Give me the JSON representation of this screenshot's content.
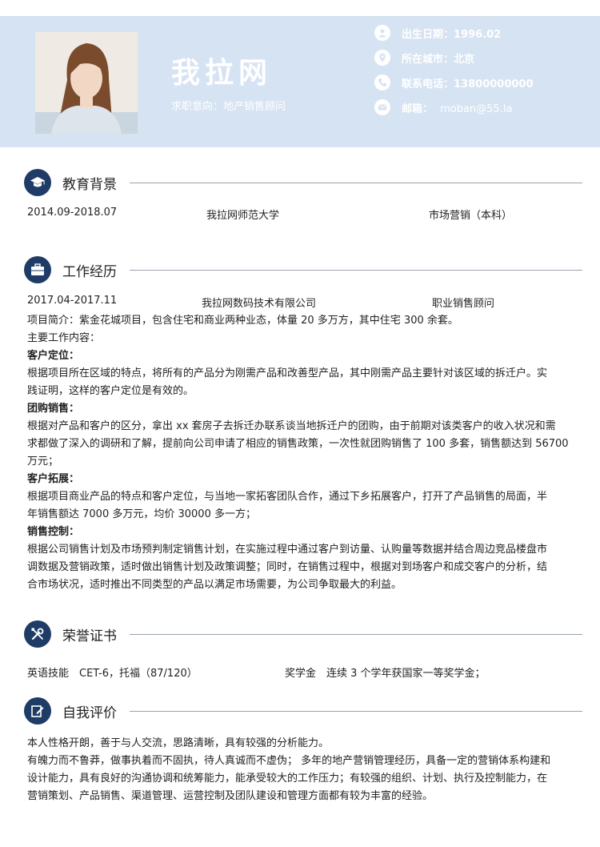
{
  "header": {
    "name": "我拉网",
    "target": "求职意向：地产销售顾问",
    "info": [
      {
        "icon": "user-icon",
        "label": "出生日期：",
        "value": "1996.02"
      },
      {
        "icon": "location-pin-icon",
        "label": "所在城市：",
        "value": "北京"
      },
      {
        "icon": "phone-icon",
        "label": "联系电话：",
        "value": "13800000000"
      },
      {
        "icon": "mail-icon",
        "label": "邮箱：",
        "value": "moban@55.la"
      }
    ]
  },
  "education": {
    "title": "教育背景",
    "period": "2014.09-2018.07",
    "school": "我拉网师范大学",
    "major": "市场营销（本科）"
  },
  "work": {
    "title": "工作经历",
    "period": "2017.04-2017.11",
    "company": "我拉网数码技术有限公司",
    "position": "职业销售顾问",
    "intro": "项目简介：紫金花城项目，包含住宅和商业两种业态，体量 20 多万方，其中住宅 300 余套。",
    "duties_label": "主要工作内容：",
    "items": [
      {
        "heading": "客户定位：",
        "lines": [
          "根据项目所在区域的特点，将所有的产品分为刚需产品和改善型产品，其中刚需产品主要针对该区域的拆迁户。实",
          "践证明，这样的客户定位是有效的。"
        ]
      },
      {
        "heading": "团购销售：",
        "lines": [
          "根据对产品和客户的区分，拿出 xx 套房子去拆迁办联系谈当地拆迁户的团购，由于前期对该类客户的收入状况和需",
          "求都做了深入的调研和了解，提前向公司申请了相应的销售政策，一次性就团购销售了 100 多套，销售额达到 56700",
          "万元；"
        ]
      },
      {
        "heading": "客户拓展：",
        "lines": [
          "根据项目商业产品的特点和客户定位，与当地一家拓客团队合作，通过下乡拓展客户，打开了产品销售的局面，半",
          "年销售额达 7000 多万元，均价 30000 多一方；"
        ]
      },
      {
        "heading": "销售控制：",
        "lines": [
          "根据公司销售计划及市场预判制定销售计划，在实施过程中通过客户到访量、认购量等数据并结合周边竞品楼盘市",
          "调数据及营销政策，适时做出销售计划及政策调整；同时，在销售过程中，根据对到场客户和成交客户的分析，结",
          "合市场状况，适时推出不同类型的产品以满足市场需要，为公司争取最大的利益。"
        ]
      }
    ]
  },
  "honors": {
    "title": "荣誉证书",
    "item1": "英语技能　CET-6，托福（87/120）",
    "item2": "奖学金　连续 3 个学年获国家一等奖学金；"
  },
  "self_eval": {
    "title": "自我评价",
    "lines": [
      "本人性格开朗，善于与人交流，思路清晰，具有较强的分析能力。",
      "有魄力而不鲁莽，做事执着而不固执，待人真诚而不虚伪；  多年的地产营销管理经历，具备一定的营销体系构建和",
      "设计能力，具有良好的沟通协调和统筹能力，能承受较大的工作压力；有较强的组织、计划、执行及控制能力，在",
      "营销策划、产品销售、渠道管理、运营控制及团队建设和管理方面都有较为丰富的经验。"
    ]
  },
  "colors": {
    "header_bg": "#d6e3f2",
    "accent": "#1f3c66"
  }
}
